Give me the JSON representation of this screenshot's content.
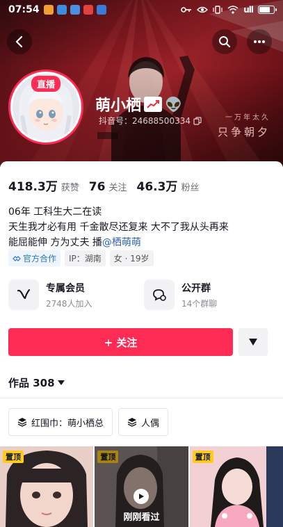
{
  "status_bar": {
    "time": "07:54",
    "battery_level": 0.8,
    "signal_text": "ull"
  },
  "header": {
    "back_icon": "chevron-left-icon",
    "search_icon": "search-icon",
    "more_icon": "more-horizontal-icon",
    "slogan_small": "一万年太久",
    "slogan_large": "只争朝夕"
  },
  "profile": {
    "live_label": "直播",
    "nickname": "萌小栖",
    "douyin_id": "抖音号：24688500334"
  },
  "stats": [
    {
      "num": "418.3万",
      "label": "获赞"
    },
    {
      "num": "76",
      "label": "关注"
    },
    {
      "num": "46.3万",
      "label": "粉丝"
    }
  ],
  "bio": {
    "line1": "06年  工科生大二在读",
    "line2": "天生我才必有用 千金散尽还复来 大不了我从头再来",
    "line3_prefix": "能屈能伸 方为丈夫  播",
    "line3_mention": "@栖萌萌"
  },
  "tags": {
    "official": "官方合作",
    "ip": "IP：湖南",
    "gender_age": "女 · 19岁"
  },
  "services": [
    {
      "title": "专属会员",
      "sub": "2748人加入"
    },
    {
      "title": "公开群",
      "sub": "14个群聊"
    }
  ],
  "actions": {
    "follow_label": "+ 关注"
  },
  "works": {
    "label": "作品 308"
  },
  "collections": [
    {
      "label": "红围巾：萌小栖总"
    },
    {
      "label": "人偶"
    }
  ],
  "videos": [
    {
      "pin_label": "置顶"
    },
    {
      "pin_label": "置顶",
      "watched_label": "刚刚看过"
    },
    {
      "pin_label": "置顶"
    }
  ],
  "colors": {
    "accent": "#fe2c55",
    "banner_red": "#a4232b",
    "pin_yellow": "#ffcc1d"
  }
}
